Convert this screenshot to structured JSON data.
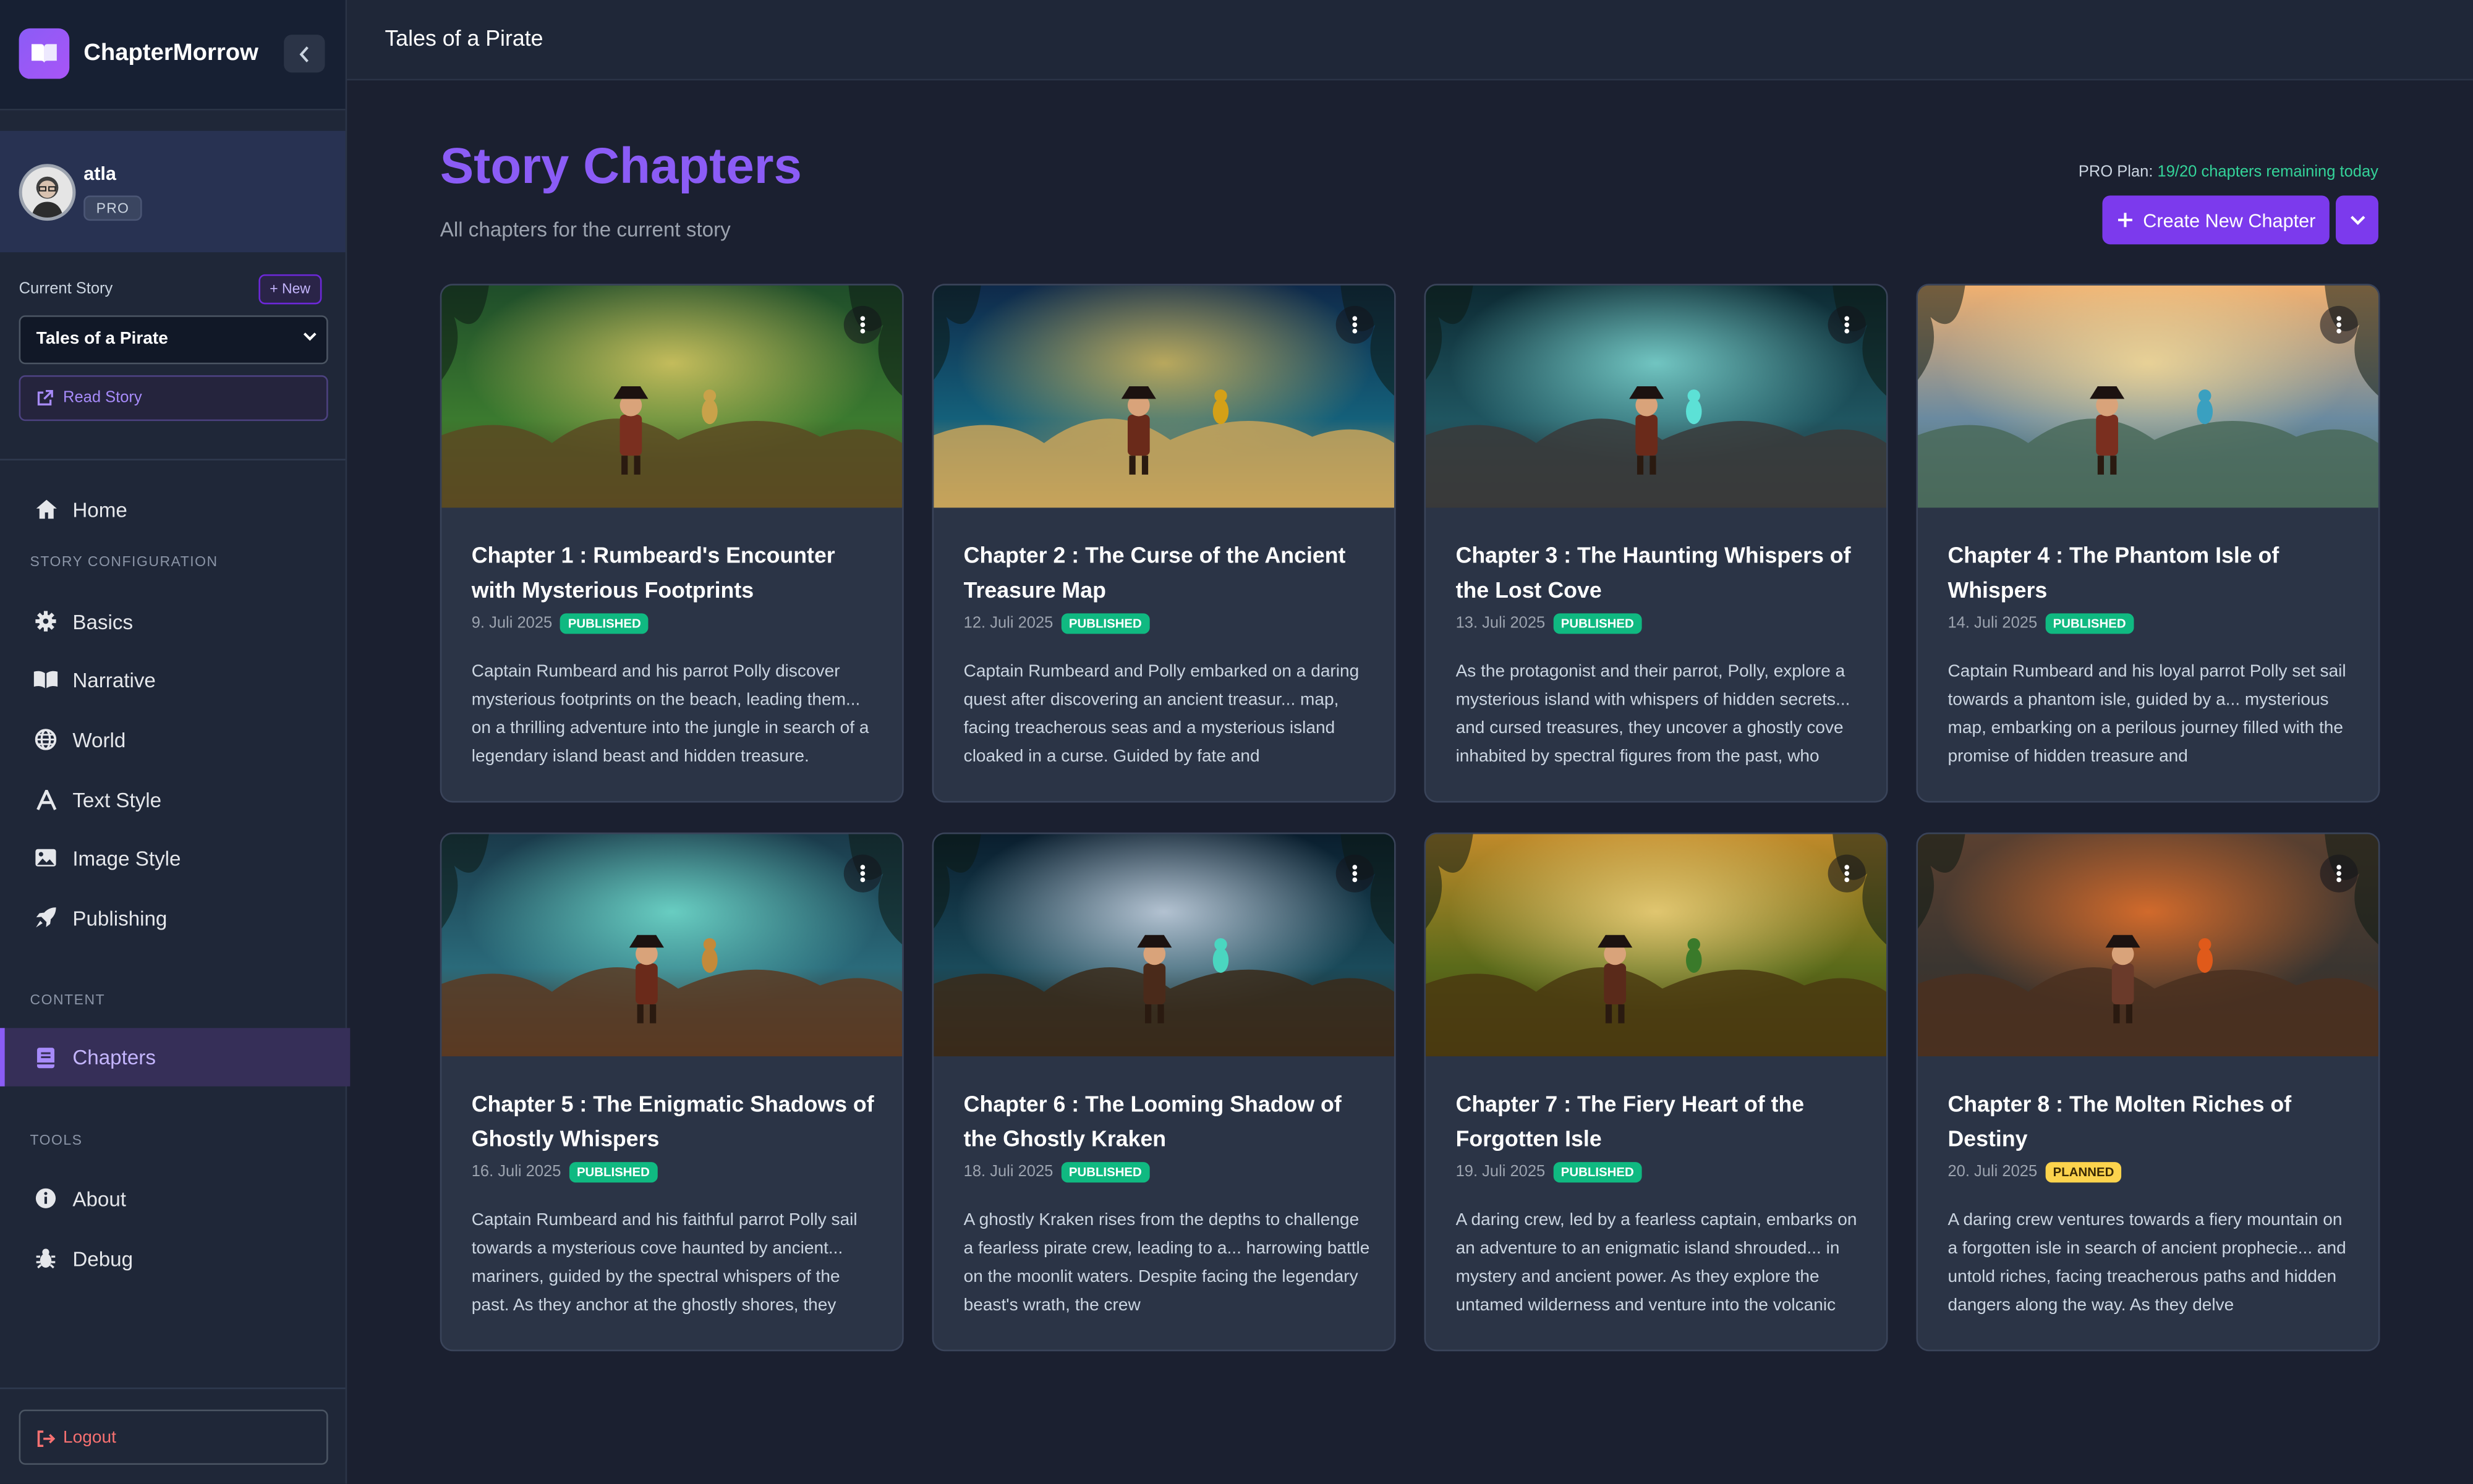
{
  "app": {
    "name": "ChapterMorrow"
  },
  "user": {
    "name": "atla",
    "plan_badge": "PRO"
  },
  "story": {
    "current_label": "Current Story",
    "new_label": "+ New",
    "selected": "Tales of a Pirate",
    "read_label": "Read Story"
  },
  "nav": {
    "home": "Home",
    "story_config_section": "STORY CONFIGURATION",
    "basics": "Basics",
    "narrative": "Narrative",
    "world": "World",
    "text_style": "Text Style",
    "image_style": "Image Style",
    "publishing": "Publishing",
    "content_section": "CONTENT",
    "chapters": "Chapters",
    "tools_section": "TOOLS",
    "about": "About",
    "debug": "Debug"
  },
  "logout_label": "Logout",
  "topbar": {
    "title": "Tales of a Pirate"
  },
  "header": {
    "title": "Story Chapters",
    "subtitle": "All chapters for the current story",
    "plan_prefix": "PRO Plan:",
    "plan_remaining": "19/20 chapters remaining today",
    "create_label": "Create New Chapter"
  },
  "colors": {
    "accent": "#8b5cf6",
    "published": "#10b981",
    "planned": "#fcd34d",
    "bg": "#1b2030"
  },
  "chapters": [
    {
      "title": "Chapter 1 : Rumbeard's Encounter with Mysterious Footprints",
      "date": "9. Juli 2025",
      "status": "PUBLISHED",
      "description": "Captain Rumbeard and his parrot Polly discover mysterious footprints on the beach, leading them... on a thrilling adventure into the jungle in search of a legendary island beast and hidden treasure."
    },
    {
      "title": "Chapter 2 : The Curse of the Ancient Treasure Map",
      "date": "12. Juli 2025",
      "status": "PUBLISHED",
      "description": "Captain Rumbeard and Polly embarked on a daring quest after discovering an ancient treasur... map, facing treacherous seas and a mysterious island cloaked in a curse. Guided by fate and"
    },
    {
      "title": "Chapter 3 : The Haunting Whispers of the Lost Cove",
      "date": "13. Juli 2025",
      "status": "PUBLISHED",
      "description": "As the protagonist and their parrot, Polly, explore a mysterious island with whispers of hidden secrets... and cursed treasures, they uncover a ghostly cove inhabited by spectral figures from the past, who"
    },
    {
      "title": "Chapter 4 : The Phantom Isle of Whispers",
      "date": "14. Juli 2025",
      "status": "PUBLISHED",
      "description": "Captain Rumbeard and his loyal parrot Polly set sail towards a phantom isle, guided by a... mysterious map, embarking on a perilous journey filled with the promise of hidden treasure and"
    },
    {
      "title": "Chapter 5 : The Enigmatic Shadows of Ghostly Whispers",
      "date": "16. Juli 2025",
      "status": "PUBLISHED",
      "description": "Captain Rumbeard and his faithful parrot Polly sail towards a mysterious cove haunted by ancient... mariners, guided by the spectral whispers of the past. As they anchor at the ghostly shores, they"
    },
    {
      "title": "Chapter 6 : The Looming Shadow of the Ghostly Kraken",
      "date": "18. Juli 2025",
      "status": "PUBLISHED",
      "description": "A ghostly Kraken rises from the depths to challenge a fearless pirate crew, leading to a... harrowing battle on the moonlit waters. Despite facing the legendary beast's wrath, the crew"
    },
    {
      "title": "Chapter 7 : The Fiery Heart of the Forgotten Isle",
      "date": "19. Juli 2025",
      "status": "PUBLISHED",
      "description": "A daring crew, led by a fearless captain, embarks on an adventure to an enigmatic island shrouded... in mystery and ancient power. As they explore the untamed wilderness and venture into the volcanic"
    },
    {
      "title": "Chapter 8 : The Molten Riches of Destiny",
      "date": "20. Juli 2025",
      "status": "PLANNED",
      "description": "A daring crew ventures towards a fiery mountain on a forgotten isle in search of ancient prophecie... and untold riches, facing treacherous paths and hidden dangers along the way. As they delve"
    }
  ]
}
